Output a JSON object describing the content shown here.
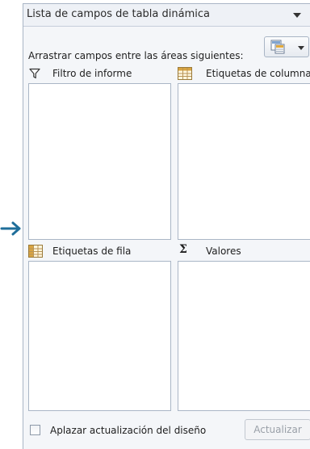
{
  "panel": {
    "title": "Lista de campos de tabla dinámica",
    "instruction": "Arrastrar campos entre las áreas siguientes:"
  },
  "areas": {
    "filter_label": "Filtro de informe",
    "columns_label": "Etiquetas de columna",
    "rows_label": "Etiquetas de fila",
    "values_label": "Valores"
  },
  "footer": {
    "defer_label": "Aplazar actualización del diseño",
    "defer_checked": false,
    "update_label": "Actualizar",
    "update_enabled": false
  },
  "icons": {
    "pointer": "arrow-right-icon",
    "filter": "funnel-icon",
    "columns": "table-grid-icon",
    "rows": "table-grid-icon",
    "values": "sigma-icon",
    "layout": "layout-options-icon"
  },
  "colors": {
    "arrow": "#1f6e9a",
    "panel_bg": "#f4f6f9",
    "border": "#a9b5c5",
    "disabled_text": "#9aa0a8"
  }
}
